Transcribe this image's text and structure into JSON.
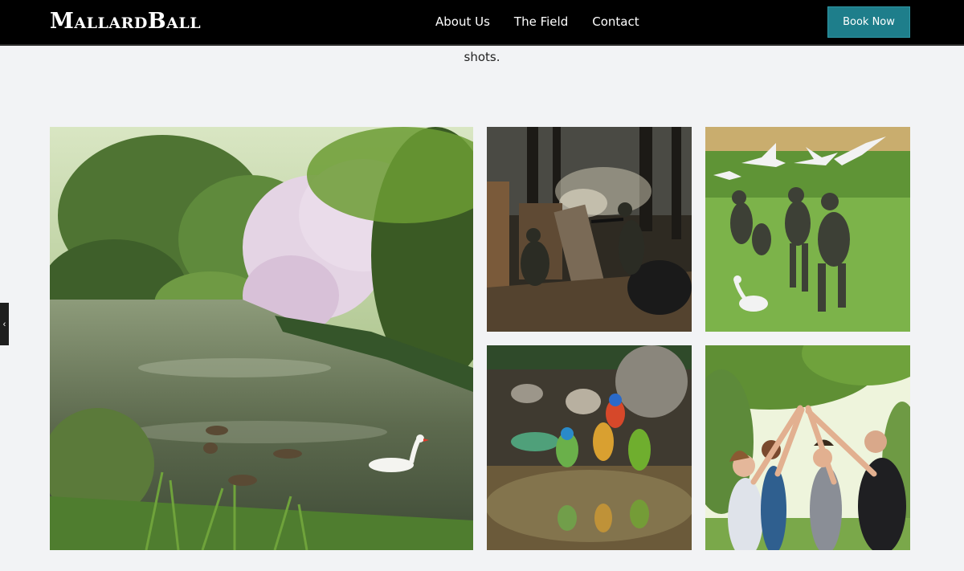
{
  "brand": {
    "logo_text": "MallardBall"
  },
  "nav": {
    "items": [
      "About Us",
      "The Field",
      "Contact"
    ]
  },
  "cta": {
    "book_label": "Book Now",
    "accent_color": "#1e7e8b"
  },
  "intro": {
    "trailing_text": "shots."
  },
  "carousel": {
    "prev_icon": "chevron-left-icon",
    "prev_glyph": "‹"
  },
  "gallery": {
    "images": [
      {
        "alt": "Pond with ducks and a white swan under blossoming trees"
      },
      {
        "alt": "Paintball players taking cover behind barrels in a smoky forest"
      },
      {
        "alt": "Paintball players running across a field with geese flying"
      },
      {
        "alt": "Colourful birds drinking from a puddle among rocks"
      },
      {
        "alt": "Friends giving a high five in a sunny park"
      }
    ]
  }
}
